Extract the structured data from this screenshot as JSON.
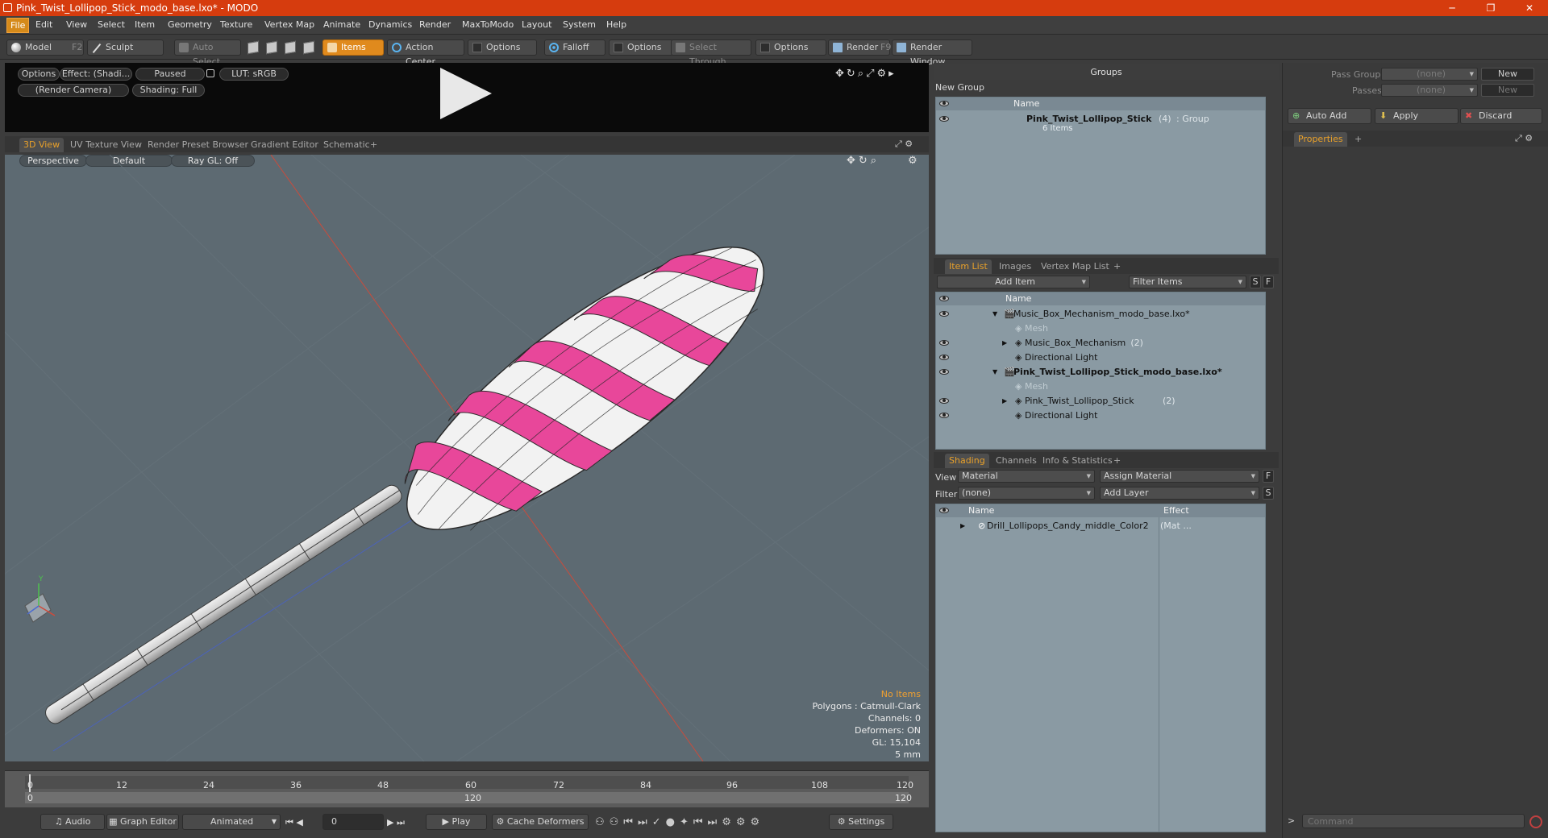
{
  "window": {
    "title": "Pink_Twist_Lollipop_Stick_modo_base.lxo* - MODO",
    "minimize": "─",
    "maximize": "❐",
    "close": "✕"
  },
  "menu": [
    "File",
    "Edit",
    "View",
    "Select",
    "Item",
    "Geometry",
    "Texture",
    "Vertex Map",
    "Animate",
    "Dynamics",
    "Render",
    "MaxToModo",
    "Layout",
    "System",
    "Help"
  ],
  "toolbar": {
    "model": "Model",
    "model_key": "F2",
    "sculpt": "Sculpt",
    "auto_select": "Auto Select",
    "items": "Items",
    "action_center": "Action Center",
    "options1": "Options",
    "falloff": "Falloff",
    "options2": "Options",
    "select_through": "Select Through",
    "options3": "Options",
    "render": "Render",
    "render_key": "F9",
    "render_window": "Render Window"
  },
  "preview": {
    "options": "Options",
    "effect": "Effect: (Shadi...",
    "paused": "Paused",
    "lut": "LUT: sRGB",
    "camera": "(Render Camera)",
    "shading": "Shading: Full"
  },
  "view_tabs": [
    "3D View",
    "UV Texture View",
    "Render Preset Browser",
    "Gradient Editor",
    "Schematic",
    "+"
  ],
  "viewport": {
    "perspective": "Perspective",
    "default": "Default",
    "raygl": "Ray GL: Off",
    "stats": {
      "no_items": "No Items",
      "polygons": "Polygons : Catmull-Clark",
      "channels": "Channels: 0",
      "deformers": "Deformers: ON",
      "gl": "GL: 15,104",
      "size": "5 mm"
    },
    "axis_y": "Y"
  },
  "timeline": {
    "ticks": [
      "0",
      "12",
      "24",
      "36",
      "48",
      "60",
      "72",
      "84",
      "96",
      "108",
      "120"
    ],
    "bottom_start": "0",
    "bottom_mid": "120",
    "bottom_end": "120"
  },
  "bottombar": {
    "audio": "Audio",
    "graph_editor": "Graph Editor",
    "animated": "Animated",
    "frame": "0",
    "play": "Play",
    "cache": "Cache Deformers",
    "settings": "Settings"
  },
  "groups": {
    "title": "Groups",
    "new_group": "New Group",
    "col_name": "Name",
    "item_name": "Pink_Twist_Lollipop_Stick",
    "item_count": "(4)",
    "item_type": ": Group",
    "item_sub": "6 Items"
  },
  "itemlist": {
    "tabs": [
      "Item List",
      "Images",
      "Vertex Map List",
      "+"
    ],
    "add_item": "Add Item",
    "filter": "Filter Items",
    "s": "S",
    "f": "F",
    "col_name": "Name",
    "rows": [
      {
        "label": "Music_Box_Mechanism_modo_base.lxo*",
        "indent": 0,
        "bold": false,
        "dim": false
      },
      {
        "label": "Mesh",
        "indent": 1,
        "bold": false,
        "dim": true
      },
      {
        "label": "Music_Box_Mechanism",
        "suffix": "(2)",
        "indent": 1,
        "bold": false,
        "dim": false
      },
      {
        "label": "Directional Light",
        "indent": 1,
        "bold": false,
        "dim": false
      },
      {
        "label": "Pink_Twist_Lollipop_Stick_modo_base.lxo*",
        "indent": 0,
        "bold": true,
        "dim": false
      },
      {
        "label": "Mesh",
        "indent": 1,
        "bold": false,
        "dim": true
      },
      {
        "label": "Pink_Twist_Lollipop_Stick",
        "suffix": "(2)",
        "indent": 1,
        "bold": false,
        "dim": false
      },
      {
        "label": "Directional Light",
        "indent": 1,
        "bold": false,
        "dim": false
      }
    ]
  },
  "shading": {
    "tabs": [
      "Shading",
      "Channels",
      "Info & Statistics",
      "+"
    ],
    "view_label": "View",
    "view_value": "Material",
    "assign": "Assign Material",
    "f": "F",
    "filter_label": "Filter",
    "filter_value": "(none)",
    "add_layer": "Add Layer",
    "s": "S",
    "col_name": "Name",
    "col_effect": "Effect",
    "row": "Drill_Lollipops_Candy_middle_Color2",
    "row_suffix": "(Mat ..."
  },
  "passes": {
    "pass_groups": "Pass Groups",
    "passes": "Passes",
    "none1": "(none)",
    "none2": "(none)",
    "new1": "New",
    "new2": "New",
    "auto_add": "Auto Add",
    "apply": "Apply",
    "discard": "Discard",
    "properties": "Properties",
    "plus": "+"
  },
  "command": {
    "placeholder": "Command",
    "arrow": ">"
  }
}
